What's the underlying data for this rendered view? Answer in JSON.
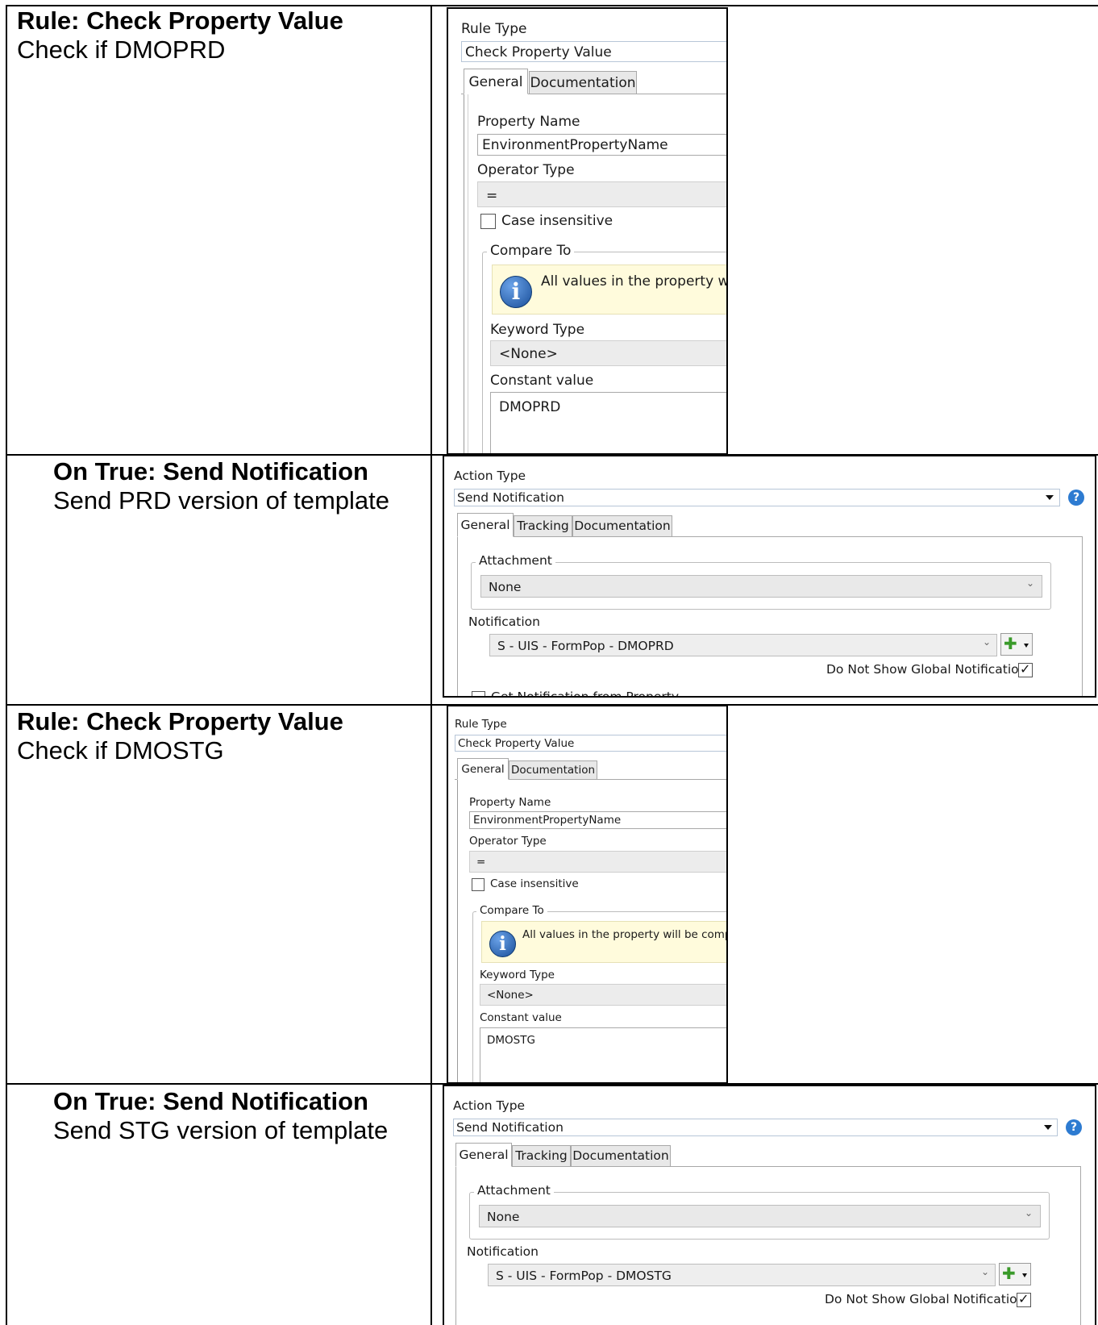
{
  "rows": [
    {
      "title": "Rule: Check Property Value",
      "desc": "Check if DMOPRD"
    },
    {
      "title": "On True: Send Notification",
      "desc": "Send PRD version of template"
    },
    {
      "title": "Rule: Check Property Value",
      "desc": "Check if DMOSTG"
    },
    {
      "title": "On True: Send Notification",
      "desc": "Send STG version of template"
    }
  ],
  "rule1": {
    "rule_type_label": "Rule Type",
    "rule_type_value": "Check Property Value",
    "tabs": [
      "General",
      "Documentation"
    ],
    "property_name_label": "Property Name",
    "property_name_value": "EnvironmentPropertyName",
    "operator_type_label": "Operator Type",
    "operator_type_value": "=",
    "case_insensitive_label": "Case insensitive",
    "compare_to_label": "Compare To",
    "info_text": "All values in the property will",
    "keyword_type_label": "Keyword Type",
    "keyword_type_value": "<None>",
    "constant_value_label": "Constant value",
    "constant_value": "DMOPRD"
  },
  "action1": {
    "action_type_label": "Action Type",
    "action_type_value": "Send Notification",
    "tabs": [
      "General",
      "Tracking",
      "Documentation"
    ],
    "attachment_label": "Attachment",
    "attachment_value": "None",
    "notification_label": "Notification",
    "notification_value": "S - UIS - FormPop - DMOPRD",
    "global_label": "Do Not Show Global Notifications",
    "get_notification_label": "Get Notification from Property"
  },
  "rule2": {
    "rule_type_label": "Rule Type",
    "rule_type_value": "Check Property Value",
    "tabs": [
      "General",
      "Documentation"
    ],
    "property_name_label": "Property Name",
    "property_name_value": "EnvironmentPropertyName",
    "operator_type_label": "Operator Type",
    "operator_type_value": "=",
    "case_insensitive_label": "Case insensitive",
    "compare_to_label": "Compare To",
    "info_text": "All values in the property will be compar",
    "keyword_type_label": "Keyword Type",
    "keyword_type_value": "<None>",
    "constant_value_label": "Constant value",
    "constant_value": "DMOSTG"
  },
  "action2": {
    "action_type_label": "Action Type",
    "action_type_value": "Send Notification",
    "tabs": [
      "General",
      "Tracking",
      "Documentation"
    ],
    "attachment_label": "Attachment",
    "attachment_value": "None",
    "notification_label": "Notification",
    "notification_value": "S - UIS - FormPop - DMOSTG",
    "global_label": "Do Not Show Global Notifications"
  }
}
